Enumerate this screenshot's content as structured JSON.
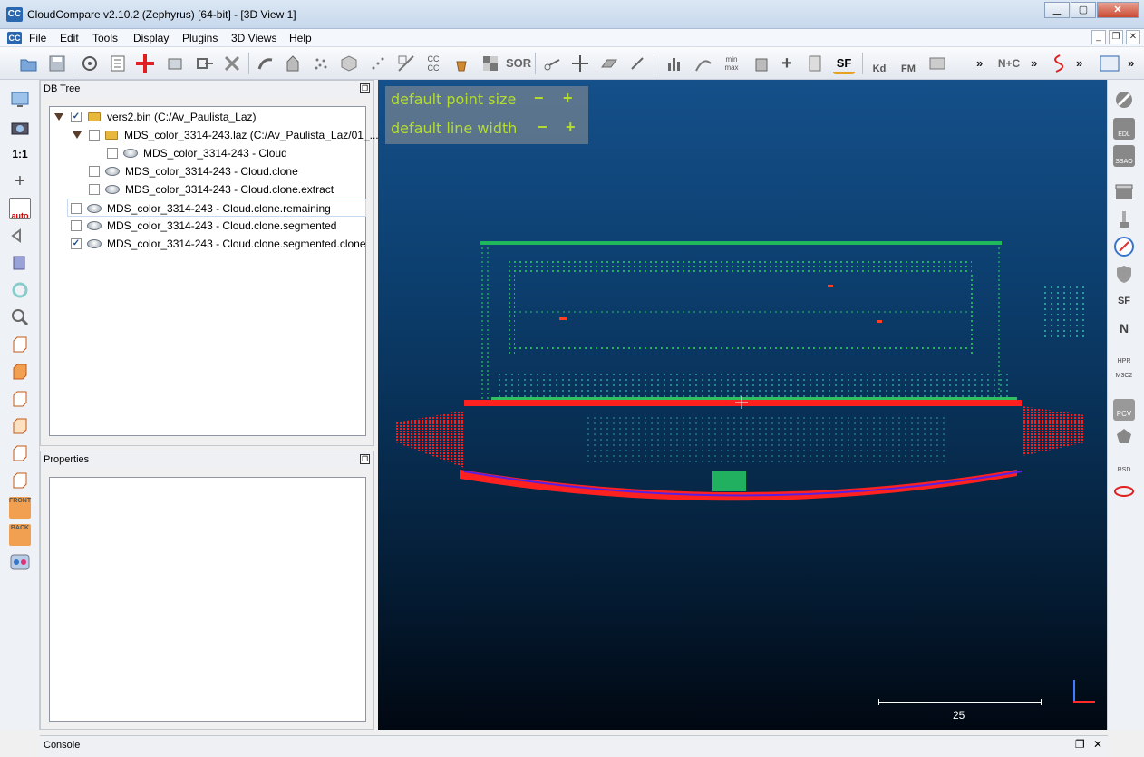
{
  "window": {
    "logo_text": "CC",
    "title": "CloudCompare v2.10.2 (Zephyrus) [64-bit] - [3D View 1]",
    "minimize": "▁",
    "maximize": "▢",
    "close": "✕"
  },
  "menu": {
    "items": [
      "File",
      "Edit",
      "Tools",
      "Display",
      "Plugins",
      "3D Views",
      "Help"
    ],
    "mdi_minimize": "_",
    "mdi_restore": "❐",
    "mdi_close": "✕"
  },
  "toolbar": {
    "icons": [
      "open-icon",
      "save-icon",
      "sample-points-icon",
      "list-icon",
      "add-point-icon",
      "crop-icon",
      "export-icon",
      "delete-icon",
      "move-icon",
      "segment-icon",
      "subsample-icon",
      "mesh-icon",
      "normals-icon",
      "octree-icon",
      "compute-cc-icon",
      "bucket-icon",
      "checker-icon",
      "sor-icon",
      "scissors-icon",
      "translate-icon",
      "plane-icon",
      "pin-icon",
      "histogram-icon",
      "sf-gradient-icon",
      "minmax-icon",
      "trash-icon",
      "plus-icon",
      "calculator-icon",
      "sf-icon",
      "kd-icon",
      "fm-icon",
      "image-icon",
      "n-c-icon",
      "curve-icon",
      "canupo-icon"
    ],
    "cc_label": "CC\nCC",
    "sor_label": "SOR",
    "sf_label": "SF",
    "kd_label": "Kd",
    "fm_label": "FM",
    "nc_label": "N+C",
    "minmax_label": "min\nmax",
    "more": "»"
  },
  "left_toolbar": {
    "one_to_one": "1:1",
    "auto": "auto",
    "front": "FRONT",
    "back": "BACK"
  },
  "db_tree": {
    "title": "DB Tree",
    "rows": [
      {
        "label": "vers2.bin (C:/Av_Paulista_Laz)",
        "checked": "✓"
      },
      {
        "label": "MDS_color_3314-243.laz (C:/Av_Paulista_Laz/01_...",
        "checked": ""
      },
      {
        "label": "MDS_color_3314-243 - Cloud",
        "checked": ""
      },
      {
        "label": "MDS_color_3314-243 - Cloud.clone",
        "checked": ""
      },
      {
        "label": "MDS_color_3314-243 - Cloud.clone.extract",
        "checked": ""
      },
      {
        "label": "MDS_color_3314-243 - Cloud.clone.remaining",
        "checked": ""
      },
      {
        "label": "MDS_color_3314-243 - Cloud.clone.segmented",
        "checked": ""
      },
      {
        "label": "MDS_color_3314-243 - Cloud.clone.segmented.clone",
        "checked": "✓"
      }
    ]
  },
  "properties": {
    "title": "Properties"
  },
  "viewport": {
    "hud_point_size": "default point size",
    "hud_line_width": "default line width",
    "minus": "−",
    "plus": "+",
    "scale_value": "25"
  },
  "right_toolbar": {
    "edl": "EDL",
    "ssao": "SSAO",
    "n_label": "N",
    "hpr": "HPR",
    "m3c2": "M3C2",
    "pcv": "PCV",
    "rsd": "RSD",
    "sf": "SF"
  },
  "console": {
    "title": "Console",
    "float": "❐",
    "close": "✕"
  }
}
